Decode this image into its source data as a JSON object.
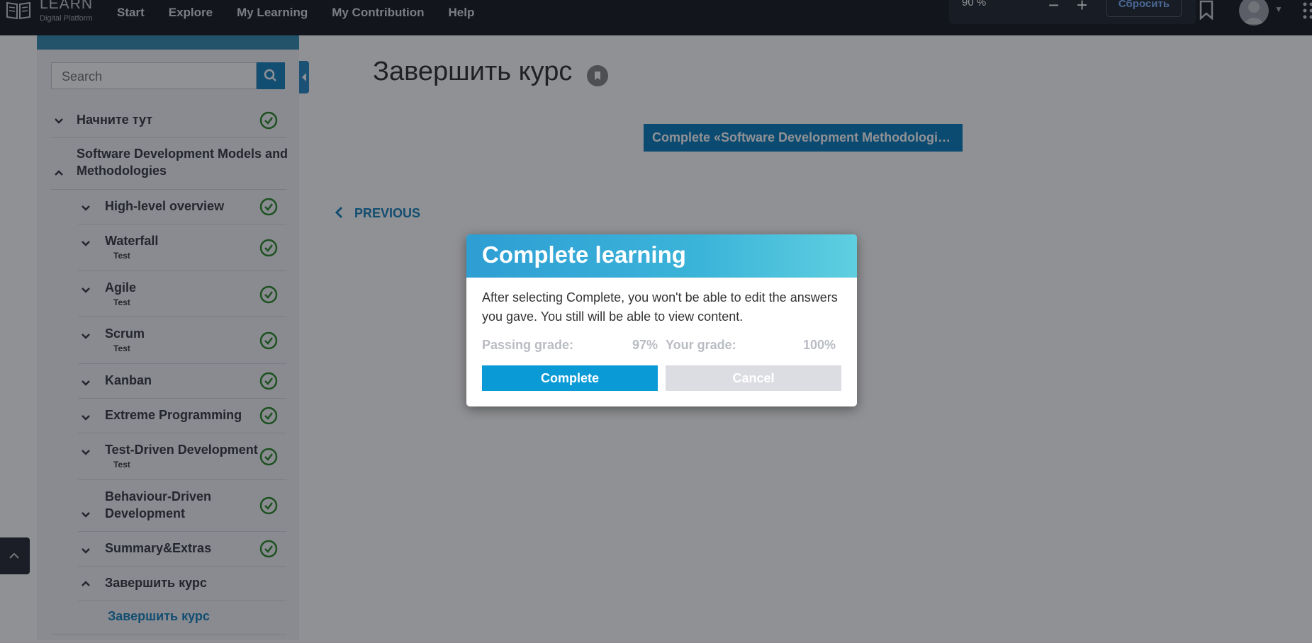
{
  "brand": {
    "title": "LEARN",
    "subtitle": "Digital Platform"
  },
  "nav": [
    "Start",
    "Explore",
    "My Learning",
    "My Contribution",
    "Help"
  ],
  "zoom": {
    "value": "90 %",
    "minus": "−",
    "plus": "+",
    "reset": "Сбросить"
  },
  "sidebar": {
    "search_placeholder": "Search",
    "items": [
      {
        "label": "Начните тут",
        "sub": "",
        "state": "collapsed",
        "completed": true
      },
      {
        "label": "Software Development Models and Methodologies",
        "sub": "",
        "state": "expanded",
        "completed": false
      },
      {
        "label": "High-level overview",
        "sub": "",
        "state": "collapsed",
        "completed": true
      },
      {
        "label": "Waterfall",
        "sub": "Test",
        "state": "collapsed",
        "completed": true
      },
      {
        "label": "Agile",
        "sub": "Test",
        "state": "collapsed",
        "completed": true
      },
      {
        "label": "Scrum",
        "sub": "Test",
        "state": "collapsed",
        "completed": true
      },
      {
        "label": "Kanban",
        "sub": "",
        "state": "collapsed",
        "completed": true
      },
      {
        "label": "Extreme Programming",
        "sub": "",
        "state": "collapsed",
        "completed": true
      },
      {
        "label": "Test-Driven Development",
        "sub": "Test",
        "state": "collapsed",
        "completed": true
      },
      {
        "label": "Behaviour-Driven Development",
        "sub": "",
        "state": "collapsed",
        "completed": true
      },
      {
        "label": "Summary&Extras",
        "sub": "",
        "state": "collapsed",
        "completed": true
      },
      {
        "label": "Завершить курс",
        "sub": "",
        "state": "expanded",
        "completed": false
      }
    ],
    "active_child": "Завершить курс"
  },
  "main": {
    "title": "Завершить курс",
    "complete_button": "Complete  «Software Development Methodologi…",
    "previous": "PREVIOUS"
  },
  "modal": {
    "title": "Complete learning",
    "body": "After selecting Complete, you won't be able to edit the answers you gave. You still will be able to view content.",
    "passing_label": "Passing grade:",
    "passing_value": "97%",
    "your_label": "Your grade:",
    "your_value": "100%",
    "complete": "Complete",
    "cancel": "Cancel"
  },
  "colors": {
    "accent": "#0a9ad6",
    "check": "#2e8b2e",
    "link": "#1b84bf"
  }
}
